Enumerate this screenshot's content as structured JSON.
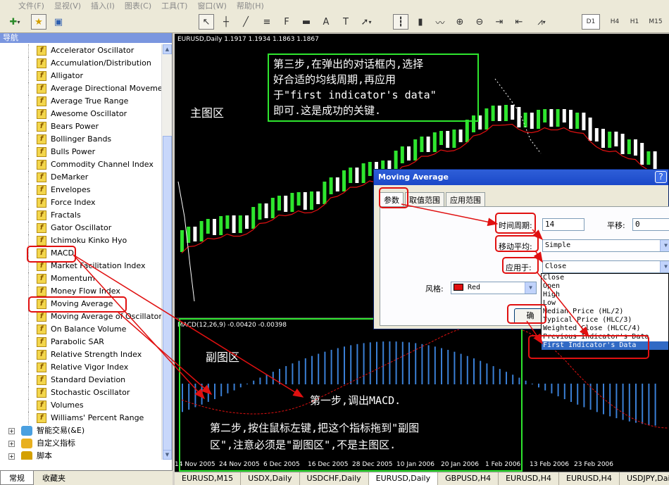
{
  "menu": [
    "文件(F)",
    "显视(V)",
    "插入(I)",
    "图表(C)",
    "工具(T)",
    "窗口(W)",
    "帮助(H)"
  ],
  "timeframes": [
    "D1",
    "H4",
    "H1",
    "M15"
  ],
  "navigator": {
    "title": "导航",
    "items": [
      "Accelerator Oscillator",
      "Accumulation/Distribution",
      "Alligator",
      "Average Directional Movement Index",
      "Average True Range",
      "Awesome Oscillator",
      "Bears Power",
      "Bollinger Bands",
      "Bulls Power",
      "Commodity Channel Index",
      "DeMarker",
      "Envelopes",
      "Force Index",
      "Fractals",
      "Gator Oscillator",
      "Ichimoku Kinko Hyo",
      "MACD",
      "Market Facilitation Index",
      "Momentum",
      "Money Flow Index",
      "Moving Average",
      "Moving Average of Oscillator",
      "On Balance Volume",
      "Parabolic SAR",
      "Relative Strength Index",
      "Relative Vigor Index",
      "Standard Deviation",
      "Stochastic Oscillator",
      "Volumes",
      "Williams' Percent Range"
    ],
    "groups": [
      "智能交易(&E)",
      "自定义指标",
      "脚本"
    ],
    "tabs": [
      "常规",
      "收藏夹"
    ]
  },
  "chart": {
    "header": "EURUSD,Daily  1.1917 1.1934 1.1863 1.1867",
    "sub_header": "MACD(12,26,9) -0.00420 -0.00398",
    "dates": [
      "14 Nov 2005",
      "24 Nov 2005",
      "6 Dec 2005",
      "16 Dec 2005",
      "28 Dec 2005",
      "10 Jan 2006",
      "20 Jan 2006",
      "1 Feb 2006",
      "13 Feb 2006",
      "23 Feb 2006"
    ],
    "main_label": "主图区",
    "sub_label": "副图区"
  },
  "notes": {
    "step3": [
      "第三步,在弹出的对话框内,选择",
      "好合适的均线周期,再应用",
      "于\"first indicator's data\"",
      "即可.这是成功的关键."
    ],
    "step1": "第一步,调出MACD.",
    "step2": [
      "第二步,按住鼠标左键,把这个指标拖到\"副图",
      "区\",注意必须是\"副图区\",不是主图区."
    ]
  },
  "dialog": {
    "title": "Moving Average",
    "tabs": [
      "参数",
      "取值范围",
      "应用范围"
    ],
    "period_label": "时间周期:",
    "period_value": "14",
    "shift_label": "平移:",
    "shift_value": "0",
    "method_label": "移动平均:",
    "method_value": "Simple",
    "apply_label": "应用于:",
    "apply_value": "Close",
    "style_label": "风格:",
    "style_value": "Red",
    "ok_label": "确",
    "apply_options": [
      "Close",
      "Open",
      "High",
      "Low",
      "Median Price (HL/2)",
      "Typical Price (HLC/3)",
      "Weighted Close (HLCC/4)",
      "Previous Indicator's Data",
      "First Indicator's Data"
    ]
  },
  "chart_tabs": [
    "EURUSD,M15",
    "USDX,Daily",
    "USDCHF,Daily",
    "EURUSD,Daily",
    "GBPUSD,H4",
    "EURUSD,H4",
    "EURUSD,H4",
    "USDJPY,Daily"
  ],
  "colors": {
    "bull": "#2ee52e",
    "bear": "#ffffff",
    "ma": "#e01010",
    "macd": "#3a7fd5",
    "annotation": "#e01010"
  }
}
